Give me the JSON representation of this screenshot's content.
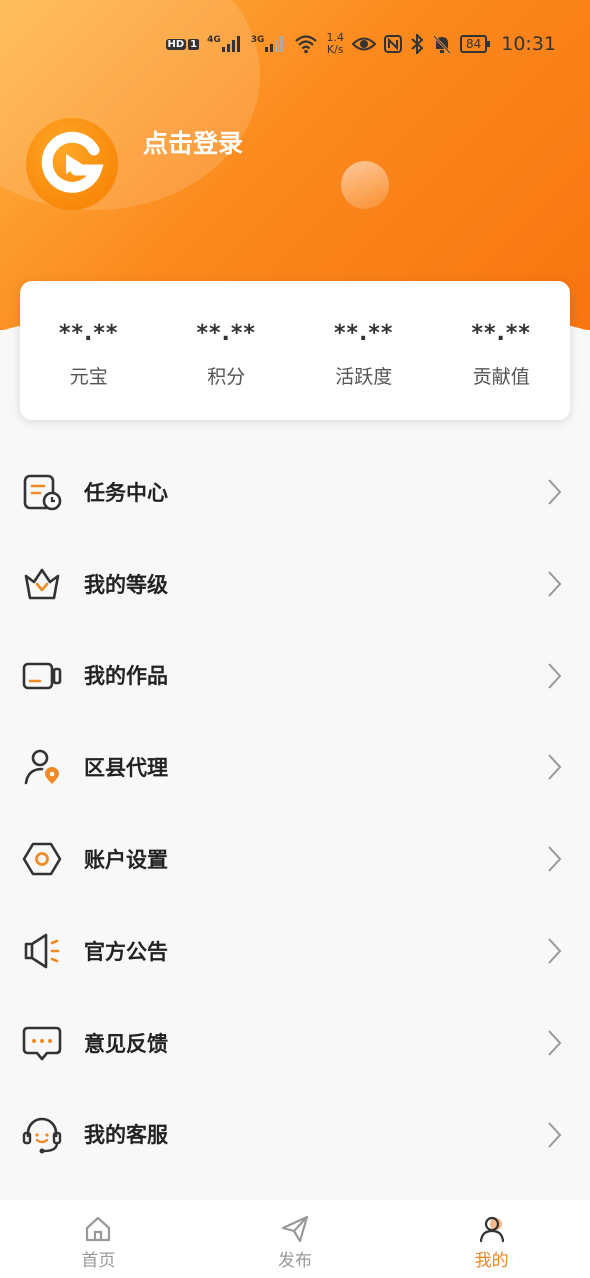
{
  "status_bar": {
    "hd": "HD",
    "sim": "1",
    "net_speed_value": "1.4",
    "net_speed_unit": "K/s",
    "battery": "84",
    "time": "10:31",
    "net1": "4G",
    "net2": "3G"
  },
  "profile": {
    "login_text": "点击登录"
  },
  "stats": [
    {
      "value": "**.**",
      "label": "元宝"
    },
    {
      "value": "**.**",
      "label": "积分"
    },
    {
      "value": "**.**",
      "label": "活跃度"
    },
    {
      "value": "**.**",
      "label": "贡献值"
    }
  ],
  "menu": [
    {
      "label": "任务中心",
      "icon": "task-center-icon"
    },
    {
      "label": "我的等级",
      "icon": "crown-icon"
    },
    {
      "label": "我的作品",
      "icon": "video-camera-icon"
    },
    {
      "label": "区县代理",
      "icon": "agent-location-icon"
    },
    {
      "label": "账户设置",
      "icon": "settings-hexagon-icon"
    },
    {
      "label": "官方公告",
      "icon": "megaphone-icon"
    },
    {
      "label": "意见反馈",
      "icon": "feedback-chat-icon"
    },
    {
      "label": "我的客服",
      "icon": "headset-service-icon"
    }
  ],
  "tabs": [
    {
      "label": "首页",
      "icon": "home-icon",
      "active": false
    },
    {
      "label": "发布",
      "icon": "send-icon",
      "active": false
    },
    {
      "label": "我的",
      "icon": "profile-icon",
      "active": true
    }
  ],
  "colors": {
    "accent": "#f8740f",
    "active_tab": "#e8862a",
    "icon_stroke": "#333333"
  }
}
